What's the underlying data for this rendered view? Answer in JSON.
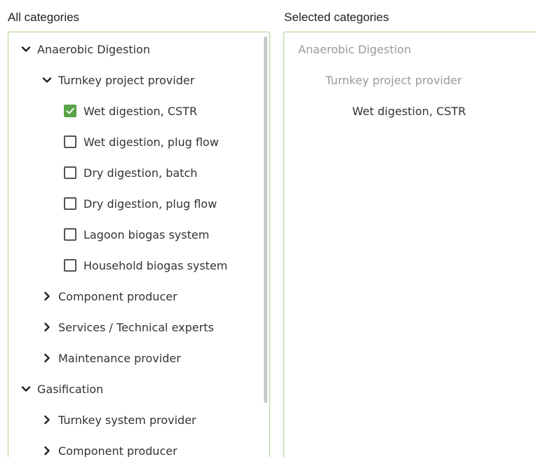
{
  "headers": {
    "all": "All categories",
    "selected": "Selected categories"
  },
  "tree": [
    {
      "label": "Anaerobic Digestion",
      "level": 0,
      "kind": "expanded"
    },
    {
      "label": "Turnkey project provider",
      "level": 1,
      "kind": "expanded"
    },
    {
      "label": "Wet digestion, CSTR",
      "level": 2,
      "kind": "checkbox",
      "checked": true
    },
    {
      "label": "Wet digestion, plug flow",
      "level": 2,
      "kind": "checkbox",
      "checked": false
    },
    {
      "label": "Dry digestion, batch",
      "level": 2,
      "kind": "checkbox",
      "checked": false
    },
    {
      "label": "Dry digestion, plug flow",
      "level": 2,
      "kind": "checkbox",
      "checked": false
    },
    {
      "label": "Lagoon biogas system",
      "level": 2,
      "kind": "checkbox",
      "checked": false
    },
    {
      "label": "Household biogas system",
      "level": 2,
      "kind": "checkbox",
      "checked": false
    },
    {
      "label": "Component producer",
      "level": 1,
      "kind": "collapsed"
    },
    {
      "label": "Services / Technical experts",
      "level": 1,
      "kind": "collapsed"
    },
    {
      "label": "Maintenance provider",
      "level": 1,
      "kind": "collapsed"
    },
    {
      "label": "Gasification",
      "level": 0,
      "kind": "expanded"
    },
    {
      "label": "Turnkey system provider",
      "level": 1,
      "kind": "collapsed"
    },
    {
      "label": "Component producer",
      "level": 1,
      "kind": "collapsed"
    }
  ],
  "selected": [
    {
      "label": "Anaerobic Digestion",
      "level": 0
    },
    {
      "label": "Turnkey project provider",
      "level": 1
    },
    {
      "label": "Wet digestion, CSTR",
      "level": 2
    }
  ],
  "colors": {
    "panel_border": "#a8d08d",
    "check_fill": "#5aa34a",
    "muted_text": "#9a9a9a"
  },
  "icons": {
    "expanded": "chevron-down-icon",
    "collapsed": "chevron-right-icon",
    "checked": "checkmark-icon"
  }
}
